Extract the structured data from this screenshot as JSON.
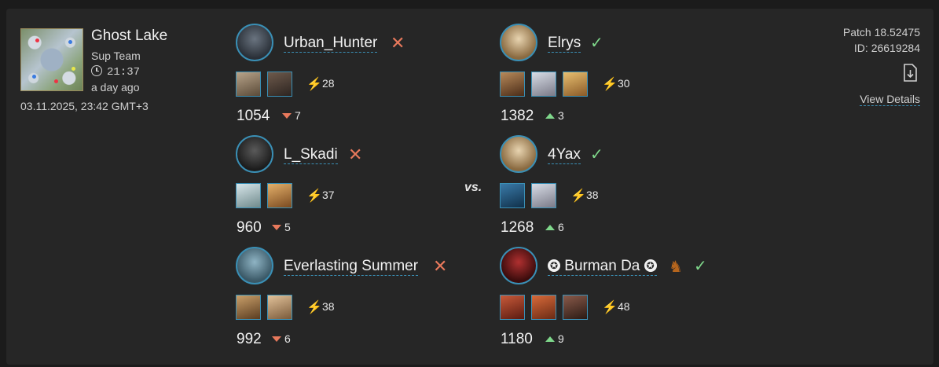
{
  "match": {
    "map_name": "Ghost Lake",
    "mode": "Sup Team",
    "duration": "21:37",
    "ago": "a day ago",
    "datetime": "03.11.2025, 23:42 GMT+3",
    "vs_label": "vs.",
    "patch": "Patch 18.52475",
    "id": "ID: 26619284",
    "view_details": "View Details"
  },
  "team_left": [
    {
      "name": "Urban_Hunter",
      "result": "loss",
      "apm": "28",
      "mmr": "1054",
      "delta": "7",
      "heroes": [
        "hero-a",
        "hero-b"
      ]
    },
    {
      "name": "L_Skadi",
      "result": "loss",
      "apm": "37",
      "mmr": "960",
      "delta": "5",
      "heroes": [
        "hero-c",
        "hero-d"
      ]
    },
    {
      "name": "Everlasting Summer",
      "result": "loss",
      "apm": "38",
      "mmr": "992",
      "delta": "6",
      "heroes": [
        "hero-e",
        "hero-f"
      ]
    }
  ],
  "team_right": [
    {
      "name": "Elrys",
      "result": "win",
      "apm": "30",
      "mmr": "1382",
      "delta": "3",
      "heroes": [
        "hero-g",
        "hero-h",
        "hero-i"
      ]
    },
    {
      "name": "4Yax",
      "result": "win",
      "apm": "38",
      "mmr": "1268",
      "delta": "6",
      "heroes": [
        "hero-j",
        "hero-k"
      ]
    },
    {
      "name": "Burman Da",
      "result": "win",
      "apm": "48",
      "mmr": "1180",
      "delta": "9",
      "heroes": [
        "hero-l",
        "hero-m",
        "hero-n"
      ]
    }
  ],
  "colors": {
    "win": "#7fd88b",
    "loss": "#e8795c",
    "accent": "#3a8fb5",
    "bolt": "#f4c430"
  }
}
